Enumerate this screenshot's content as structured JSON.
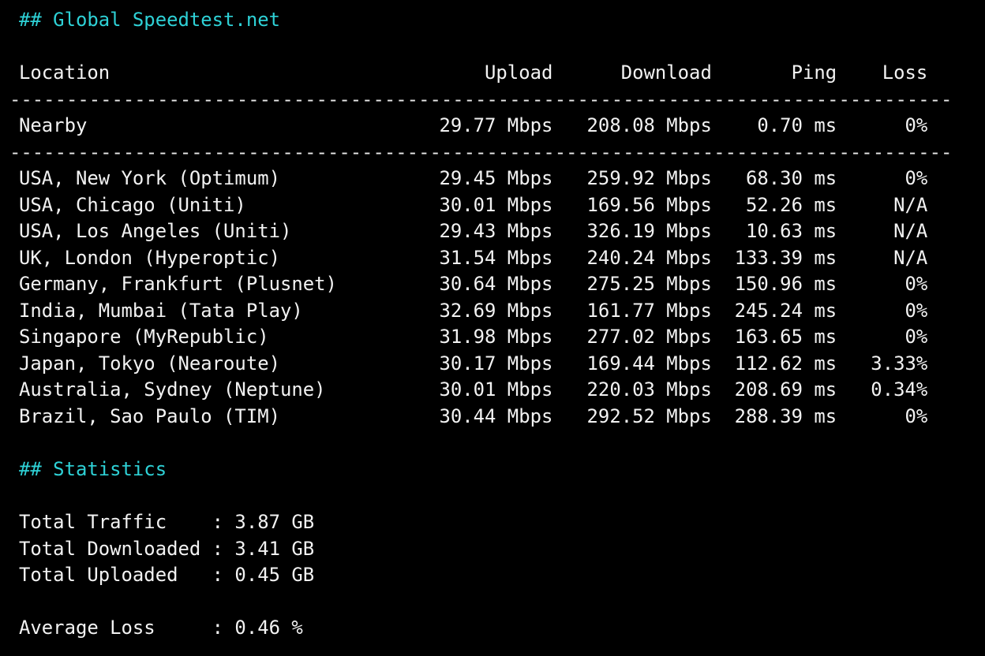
{
  "colors": {
    "background": "#000000",
    "text": "#f2f2f2",
    "heading": "#2ed1d6"
  },
  "speedtest": {
    "heading": "## Global Speedtest.net",
    "header_row": "Location                                 Upload      Download       Ping    Loss",
    "separator": "-----------------------------------------------------------------------------------",
    "nearby_row": "Nearby                               29.77 Mbps   208.08 Mbps    0.70 ms      0%",
    "rows": [
      "USA, New York (Optimum)              29.45 Mbps   259.92 Mbps   68.30 ms      0%",
      "USA, Chicago (Uniti)                 30.01 Mbps   169.56 Mbps   52.26 ms     N/A",
      "USA, Los Angeles (Uniti)             29.43 Mbps   326.19 Mbps   10.63 ms     N/A",
      "UK, London (Hyperoptic)              31.54 Mbps   240.24 Mbps  133.39 ms     N/A",
      "Germany, Frankfurt (Plusnet)         30.64 Mbps   275.25 Mbps  150.96 ms      0%",
      "India, Mumbai (Tata Play)            32.69 Mbps   161.77 Mbps  245.24 ms      0%",
      "Singapore (MyRepublic)               31.98 Mbps   277.02 Mbps  163.65 ms      0%",
      "Japan, Tokyo (Nearoute)              30.17 Mbps   169.44 Mbps  112.62 ms   3.33%",
      "Australia, Sydney (Neptune)          30.01 Mbps   220.03 Mbps  208.69 ms   0.34%",
      "Brazil, Sao Paulo (TIM)              30.44 Mbps   292.52 Mbps  288.39 ms      0%"
    ]
  },
  "statistics": {
    "heading": "## Statistics",
    "total_traffic": "Total Traffic    : 3.87 GB",
    "total_downloaded": "Total Downloaded : 3.41 GB",
    "total_uploaded": "Total Uploaded   : 0.45 GB",
    "average_loss": "Average Loss     : 0.46 %"
  }
}
